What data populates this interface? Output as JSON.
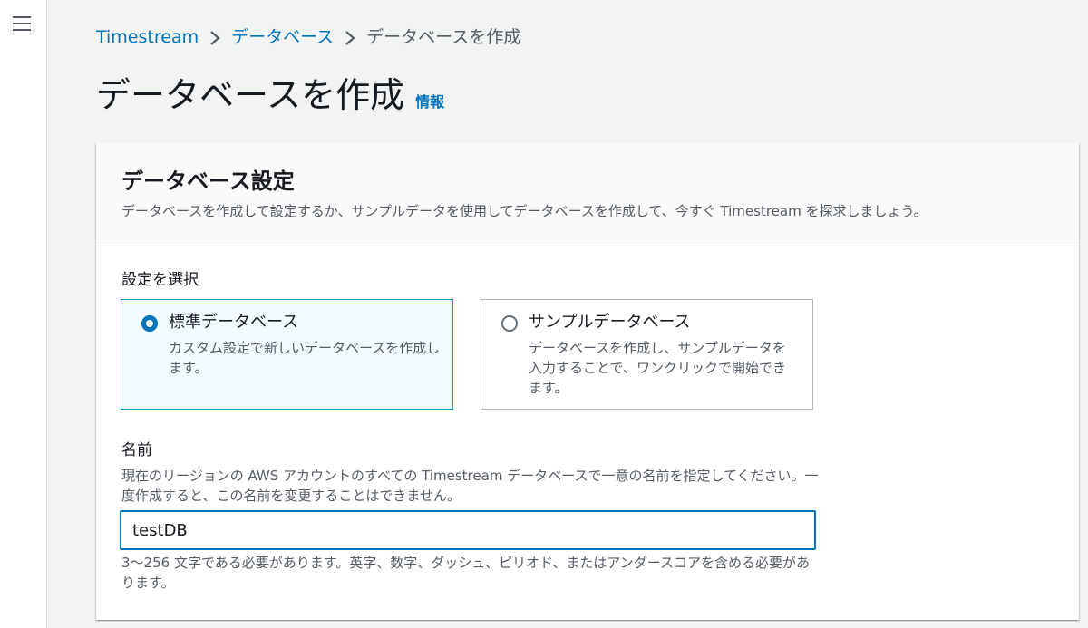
{
  "breadcrumb": {
    "items": [
      "Timestream",
      "データベース",
      "データベースを作成"
    ]
  },
  "page": {
    "title": "データベースを作成",
    "info_link": "情報"
  },
  "panel": {
    "title": "データベース設定",
    "description": "データベースを作成して設定するか、サンプルデータを使用してデータベースを作成して、今すぐ Timestream を探求しましょう。",
    "config_label": "設定を選択",
    "options": [
      {
        "title": "標準データベース",
        "description": "カスタム設定で新しいデータベースを作成します。",
        "selected": true
      },
      {
        "title": "サンプルデータベース",
        "description": "データベースを作成し、サンプルデータを入力することで、ワンクリックで開始できます。",
        "selected": false
      }
    ],
    "name_field": {
      "label": "名前",
      "description": "現在のリージョンの AWS アカウントのすべての Timestream データベースで一意の名前を指定してください。一度作成すると、この名前を変更することはできません。",
      "value": "testDB",
      "constraint": "3〜256 文字である必要があります。英字、数字、ダッシュ、ピリオド、またはアンダースコアを含める必要があります。"
    }
  },
  "icons": {
    "menu": "hamburger-menu-icon",
    "separator": "chevron-right-icon",
    "radio_checked": "radio-checked-icon",
    "radio_unchecked": "radio-unchecked-icon"
  },
  "colors": {
    "link": "#0073bb",
    "selected_tile_border": "#00a1c9",
    "selected_tile_bg": "#f1faff",
    "page_bg": "#f2f3f3"
  }
}
